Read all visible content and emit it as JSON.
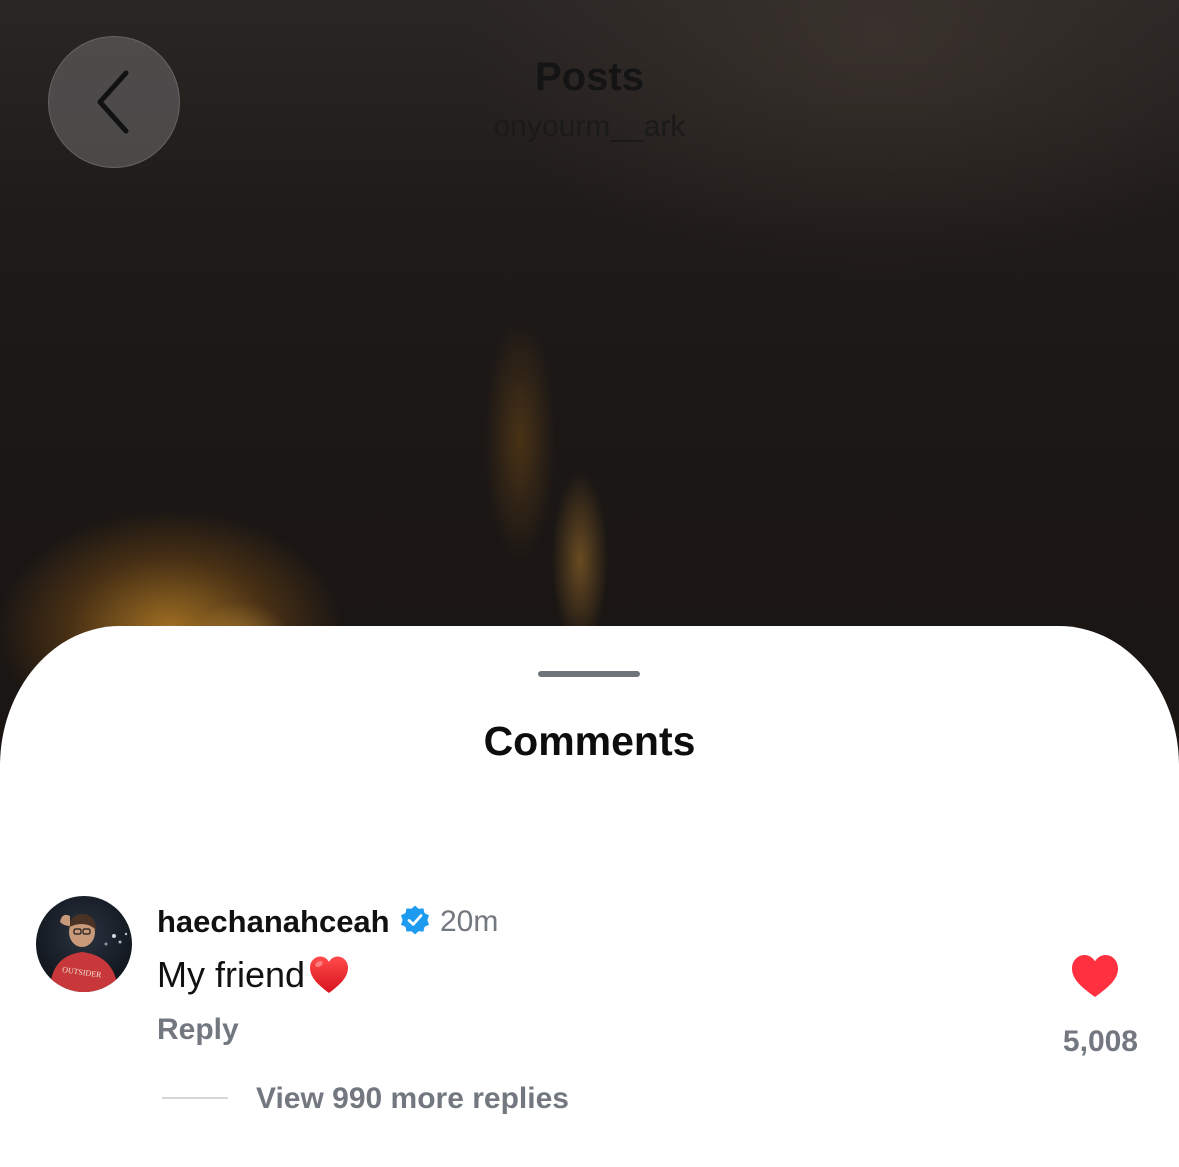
{
  "header": {
    "title": "Posts",
    "subtitle": "onyourm__ark"
  },
  "sheet": {
    "title": "Comments"
  },
  "comment": {
    "username": "haechanahceah",
    "verified": true,
    "timestamp": "20m",
    "text": "My friend",
    "text_emoji": "red-heart-emoji",
    "avatar_shirt_text": "OUTSIDER",
    "reply_label": "Reply",
    "liked": true,
    "like_count": "5,008",
    "view_replies_label": "View 990 more replies"
  },
  "icons": {
    "back": "chevron-left-icon",
    "verified": "verified-badge-icon",
    "like": "heart-filled-icon"
  },
  "colors": {
    "like_red": "#ff3040",
    "verified_blue": "#1d9bf0",
    "secondary_text": "#737880"
  }
}
